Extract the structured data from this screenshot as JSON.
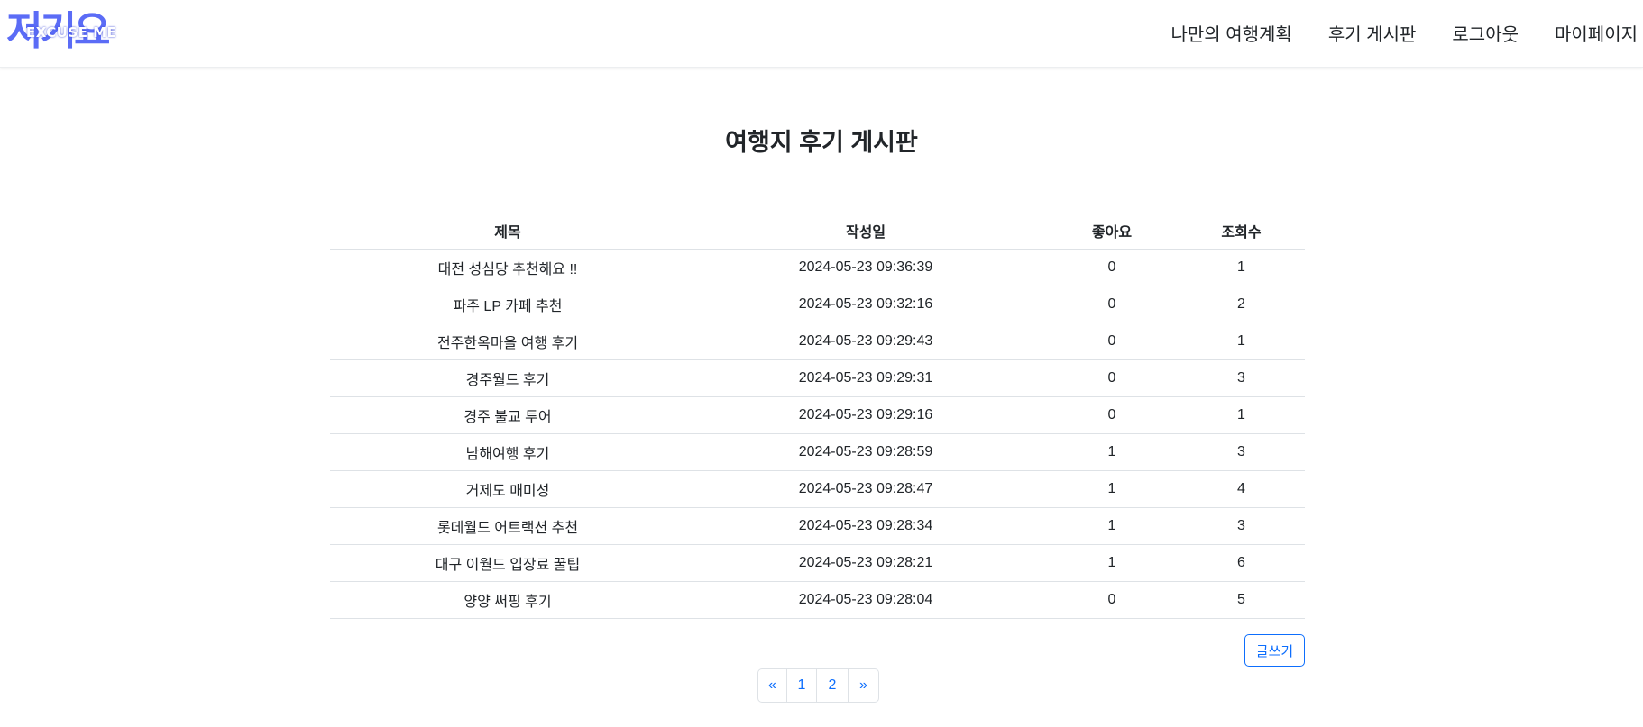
{
  "header": {
    "logo_text": "저기요",
    "logo_sub": "EXCUSE ME",
    "nav": [
      "나만의 여행계획",
      "후기 게시판",
      "로그아웃",
      "마이페이지"
    ]
  },
  "page": {
    "title": "여행지 후기 게시판"
  },
  "table": {
    "columns": [
      "제목",
      "작성일",
      "좋아요",
      "조회수"
    ],
    "rows": [
      [
        "대전 성심당 추천해요 !!",
        "2024-05-23 09:36:39",
        "0",
        "1"
      ],
      [
        "파주 LP 카페 추천",
        "2024-05-23 09:32:16",
        "0",
        "2"
      ],
      [
        "전주한옥마을 여행 후기",
        "2024-05-23 09:29:43",
        "0",
        "1"
      ],
      [
        "경주월드 후기",
        "2024-05-23 09:29:31",
        "0",
        "3"
      ],
      [
        "경주 불교 투어",
        "2024-05-23 09:29:16",
        "0",
        "1"
      ],
      [
        "남해여행 후기",
        "2024-05-23 09:28:59",
        "1",
        "3"
      ],
      [
        "거제도 매미성",
        "2024-05-23 09:28:47",
        "1",
        "4"
      ],
      [
        "롯데월드 어트랙션 추천",
        "2024-05-23 09:28:34",
        "1",
        "3"
      ],
      [
        "대구 이월드 입장료 꿀팁",
        "2024-05-23 09:28:21",
        "1",
        "6"
      ],
      [
        "양양 써핑 후기",
        "2024-05-23 09:28:04",
        "0",
        "5"
      ]
    ]
  },
  "actions": {
    "write_label": "글쓰기"
  },
  "pagination": {
    "prev": "«",
    "pages": [
      "1",
      "2"
    ],
    "next": "»"
  },
  "colors": {
    "brand": "#5b6cf6",
    "link": "#0d6efd"
  }
}
